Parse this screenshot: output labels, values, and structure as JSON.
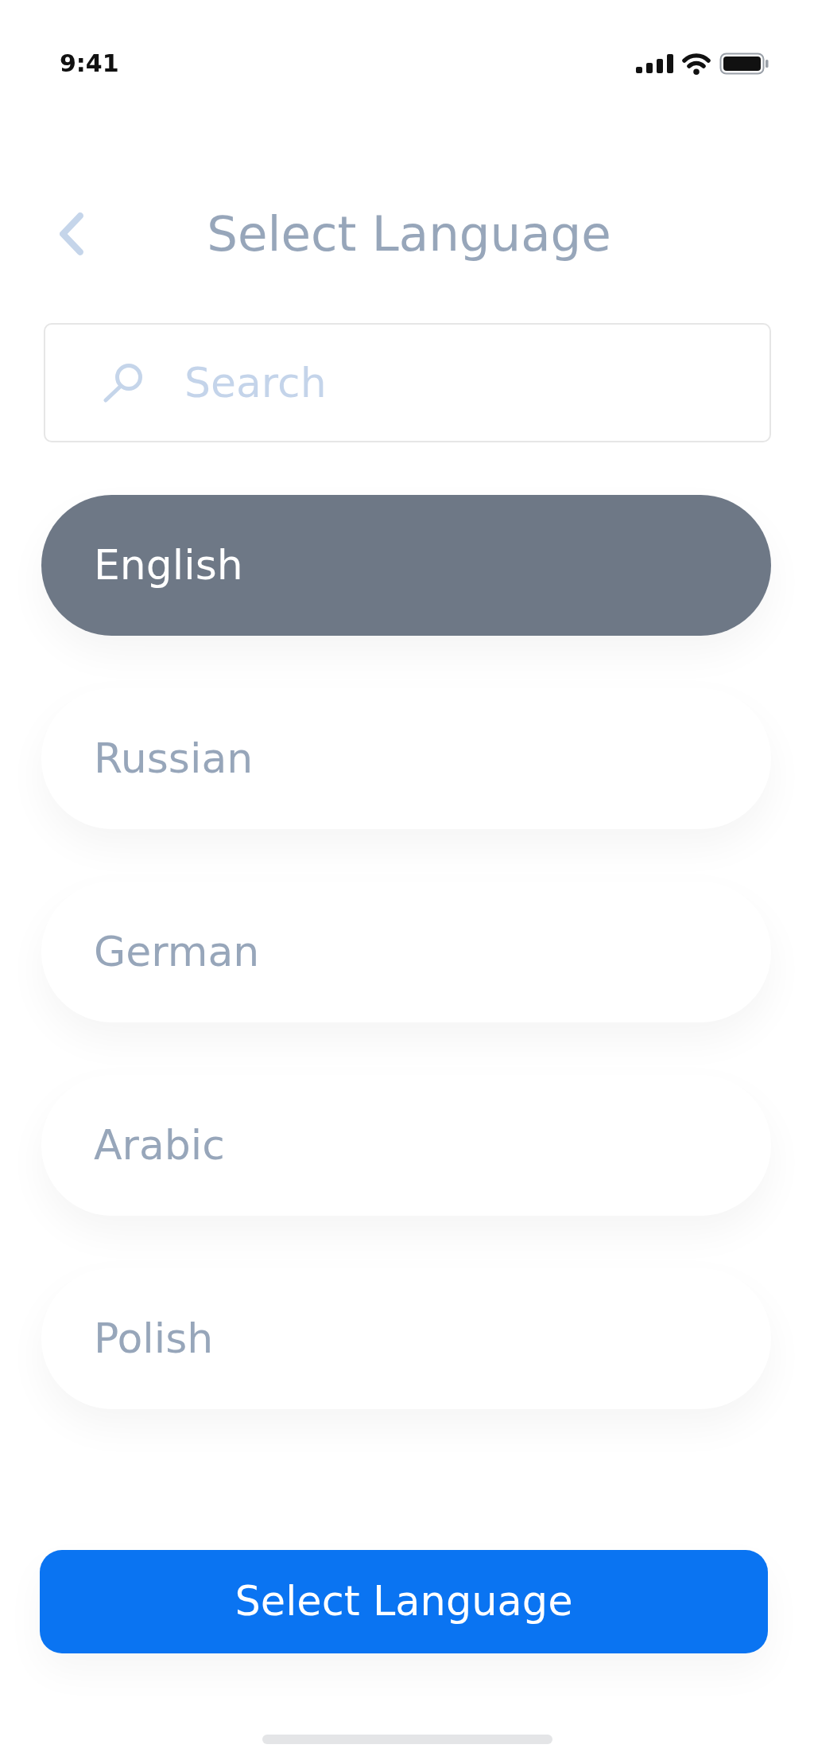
{
  "status_bar": {
    "time": "9:41"
  },
  "header": {
    "title": "Select Language"
  },
  "search": {
    "placeholder": "Search"
  },
  "languages": [
    {
      "label": "English",
      "selected": true
    },
    {
      "label": "Russian",
      "selected": false
    },
    {
      "label": "German",
      "selected": false
    },
    {
      "label": "Arabic",
      "selected": false
    },
    {
      "label": "Polish",
      "selected": false
    }
  ],
  "primary_button": {
    "label": "Select Language"
  }
}
